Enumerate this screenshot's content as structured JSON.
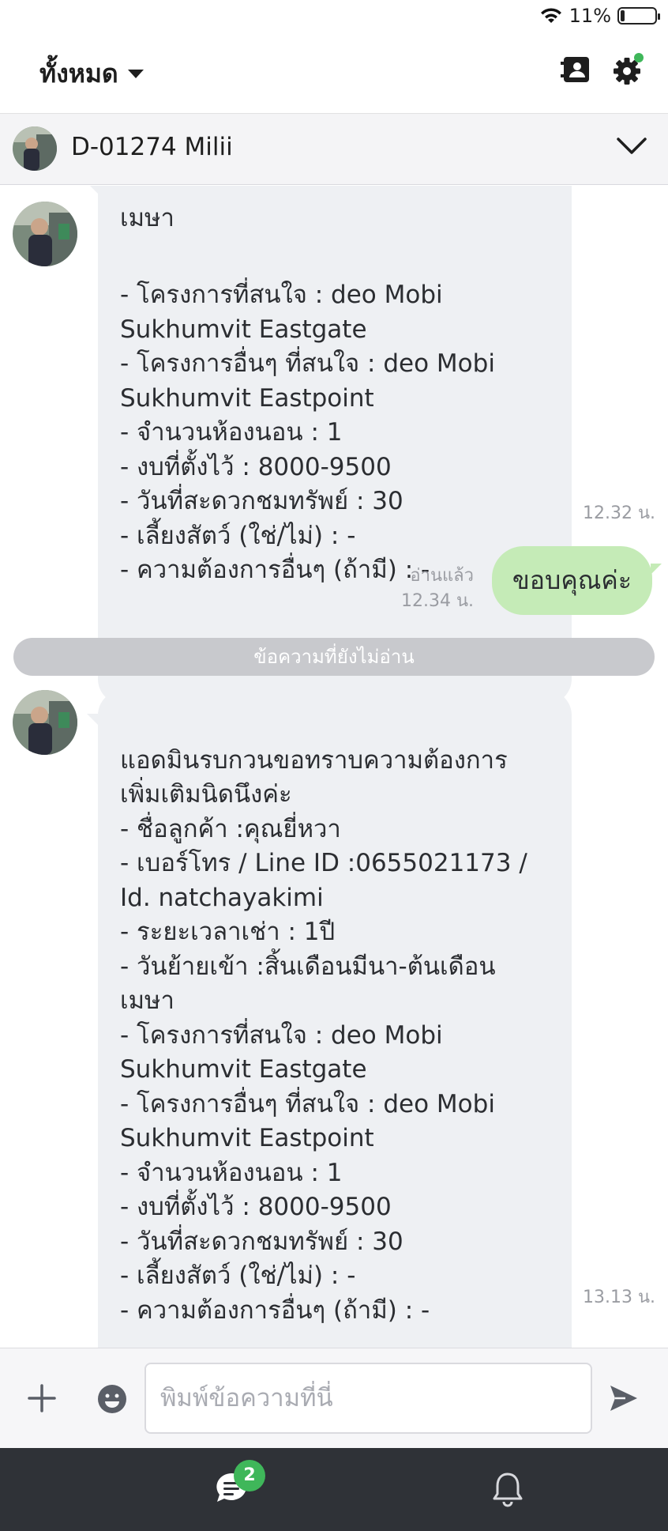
{
  "status_bar": {
    "battery_text": "11%",
    "battery_level": 0.11
  },
  "header": {
    "title": "ทั้งหมด"
  },
  "chat": {
    "contact_name": "D-01274 Milii"
  },
  "messages": {
    "first": {
      "text": "- โครงการที่สนใจ : deo Mobi\nSukhumvit Eastgate\n- โครงการอื่นๆ ที่สนใจ : deo Mobi\nSukhumvit Eastpoint\n- จำนวนห้องนอน : 1\n- งบที่ตั้งไว้ : 8000-9500\n- วันที่สะดวกชมทรัพย์ : 30\n- เลี้ยงสัตว์ (ใช่/ไม่) : -\n- ความต้องการอื่นๆ (ถ้ามี) :  -",
      "time": "12.32 น."
    },
    "outgoing": {
      "text": "ขอบคุณค่ะ",
      "read_label": "อ่านแล้ว",
      "time": "12.34 น."
    },
    "unread_divider": "ข้อความที่ยังไม่อ่าน",
    "second": {
      "text": "แอดมินรบกวนขอทราบความต้องการ\nเพิ่มเติมนิดนึงค่ะ\n- ชื่อลูกค้า :คุณยี่หวา\n- เบอร์โทร / Line ID :0655021173 /\nId. natchayakimi\n- ระยะเวลาเช่า : 1ปี\n- วันย้ายเข้า :สิ้นเดือนมีนา-ต้นเดือน\nเมษา\n- โครงการที่สนใจ : deo Mobi\nSukhumvit Eastgate\n- โครงการอื่นๆ ที่สนใจ : deo Mobi\nSukhumvit Eastpoint\n- จำนวนห้องนอน : 1\n- งบที่ตั้งไว้ : 8000-9500\n- วันที่สะดวกชมทรัพย์ : 30\n- เลี้ยงสัตว์ (ใช่/ไม่) : -\n- ความต้องการอื่นๆ (ถ้ามี) :  -",
      "time": "13.13 น."
    }
  },
  "input": {
    "placeholder": "พิมพ์ข้อความที่นี่"
  },
  "bottom_nav": {
    "chat_badge": "2"
  },
  "colors": {
    "incoming_bubble": "#eef0f3",
    "outgoing_bubble": "#c5ebb7",
    "badge_green": "#3fb75a",
    "bottom_bar": "#2f3237"
  }
}
